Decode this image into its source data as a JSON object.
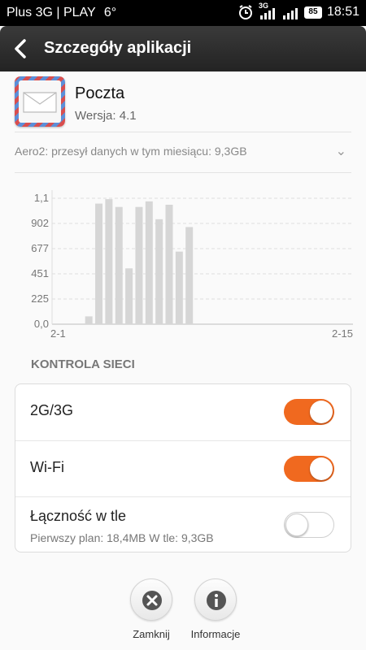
{
  "status_bar": {
    "carrier": "Plus 3G | PLAY",
    "temp": "6°",
    "network": "3G",
    "battery": "85",
    "time": "18:51"
  },
  "header": {
    "title": "Szczegóły aplikacji"
  },
  "app": {
    "name": "Poczta",
    "version": "Wersja: 4.1"
  },
  "usage": {
    "text": "Aero2: przesył danych w tym miesiącu: 9,3GB"
  },
  "chart_data": {
    "type": "bar",
    "y_ticks": [
      "1,1",
      "902",
      "677",
      "451",
      "225",
      "0,0"
    ],
    "x_start_label": "2-1",
    "x_end_label": "2-15",
    "values": [
      0,
      0,
      70,
      1080,
      1120,
      1050,
      500,
      1050,
      1100,
      940,
      1070,
      650,
      870,
      0,
      0,
      0,
      0,
      0,
      0,
      0,
      0,
      0,
      0,
      0,
      0,
      0,
      0
    ],
    "ylim": [
      0,
      1128
    ],
    "bar_color": "#d6d6d6",
    "grid": true
  },
  "network_control": {
    "title": "KONTROLA SIECI",
    "rows": [
      {
        "label": "2G/3G",
        "enabled": true
      },
      {
        "label": "Wi-Fi",
        "enabled": true
      },
      {
        "label": "Łączność w tle",
        "sub": "Pierwszy plan: 18,4MB W tle: 9,3GB",
        "enabled": false
      }
    ]
  },
  "buttons": {
    "close": {
      "label": "Zamknij",
      "icon": "close-icon"
    },
    "info": {
      "label": "Informacje",
      "icon": "info-icon"
    }
  },
  "colors": {
    "accent": "#f0691f",
    "header": "#2b2b2b"
  }
}
